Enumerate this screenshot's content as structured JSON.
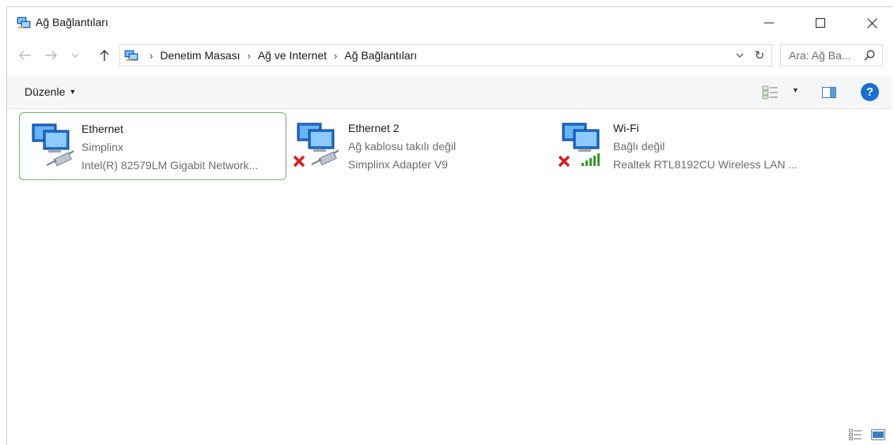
{
  "window": {
    "title": "Ağ Bağlantıları"
  },
  "address": {
    "crumbs": [
      "Denetim Masası",
      "Ağ ve Internet",
      "Ağ Bağlantıları"
    ],
    "search_placeholder": "Ara: Ağ Ba..."
  },
  "toolbar": {
    "organize_label": "Düzenle"
  },
  "items": [
    {
      "name": "Ethernet",
      "status": "Simplinx",
      "device": "Intel(R) 82579LM Gigabit Network...",
      "selected": true,
      "icon": "ethernet-cable-icon"
    },
    {
      "name": "Ethernet 2",
      "status": "Ağ kablosu takılı değil",
      "device": "Simplinx Adapter V9",
      "selected": false,
      "icon": "ethernet-cable-icon",
      "error": true
    },
    {
      "name": "Wi-Fi",
      "status": "Bağlı değil",
      "device": "Realtek RTL8192CU Wireless LAN ...",
      "selected": false,
      "icon": "wifi-signal-icon",
      "error": true
    }
  ],
  "colors": {
    "selection_border": "#6db56d",
    "help": "#1a6fd1",
    "error": "#d61f1f",
    "signal": "#3a9a2a"
  }
}
